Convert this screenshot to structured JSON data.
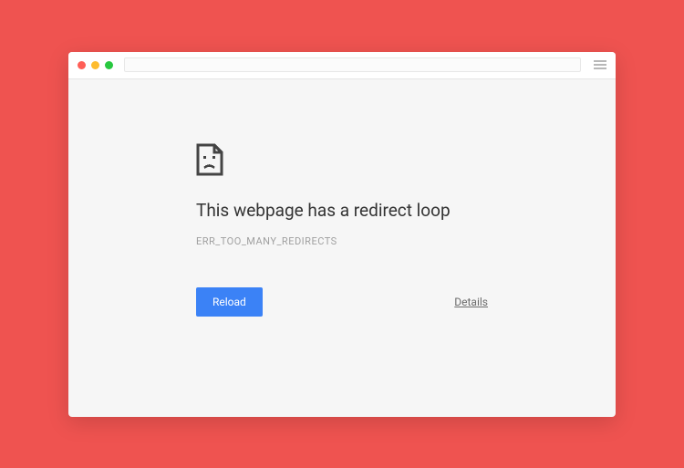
{
  "error": {
    "title": "This webpage has a redirect loop",
    "code": "ERR_TOO_MANY_REDIRECTS",
    "reload_label": "Reload",
    "details_label": "Details"
  }
}
